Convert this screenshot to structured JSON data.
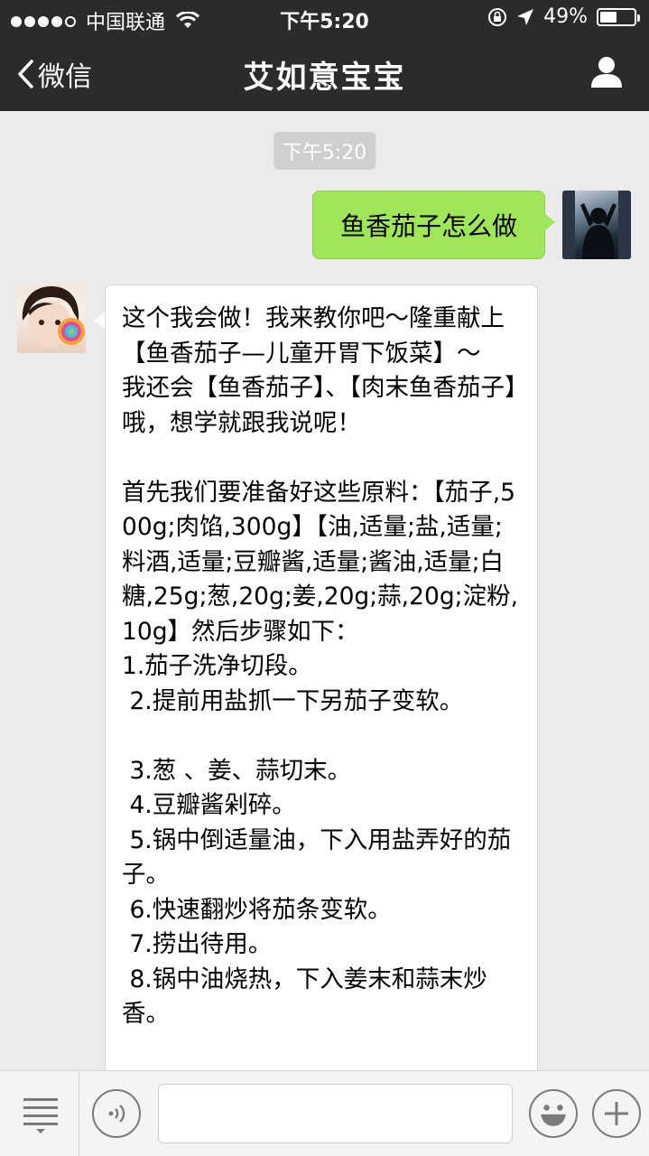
{
  "status_bar": {
    "carrier": "中国联通",
    "time": "下午5:20",
    "battery_text": "49%",
    "battery_level": 0.49
  },
  "nav": {
    "back_label": "微信",
    "title": "艾如意宝宝"
  },
  "chat": {
    "timestamp": "下午5:20",
    "outgoing_message": "鱼香茄子怎么做",
    "incoming_message": "这个我会做！我来教你吧～隆重献上【鱼香茄子—儿童开胃下饭菜】～\n我还会【鱼香茄子】、【肉末鱼香茄子】哦，想学就跟我说呢！\n\n首先我们要准备好这些原料：【茄子,500g;肉馅,300g】【油,适量;盐,适量;料酒,适量;豆瓣酱,适量;酱油,适量;白糖,25g;葱,20g;姜,20g;蒜,20g;淀粉,10g】然后步骤如下：\n1.茄子洗净切段。\n 2.提前用盐抓一下另茄子变软。\n\n 3.葱 、姜、蒜切末。\n 4.豆瓣酱剁碎。\n 5.锅中倒适量油，下入用盐弄好的茄子。\n 6.快速翻炒将茄条变软。\n 7.捞出待用。\n 8.锅中油烧热，下入姜末和蒜末炒香。"
  },
  "colors": {
    "header_bg": "#2b2b2e",
    "chat_bg": "#ebebeb",
    "outgoing_bubble": "#9fe658",
    "incoming_bubble": "#ffffff"
  }
}
